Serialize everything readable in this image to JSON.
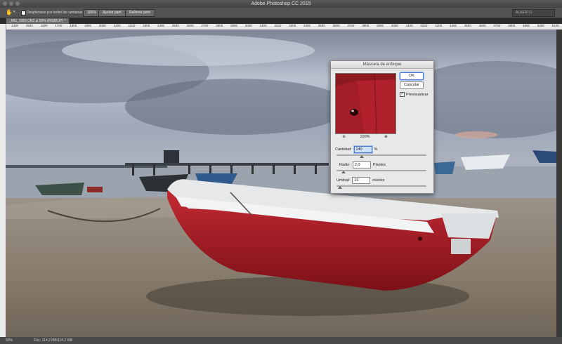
{
  "window": {
    "title": "Adobe Photoshop CC 2015"
  },
  "options_bar": {
    "scroll_all_label": "Desplazarse por todas las ventanas",
    "zoom_100_label": "100%",
    "fit_screen_label": "Ajustar pant.",
    "fill_screen_label": "Rellenar pant.",
    "workspace_label": "ALBERTO"
  },
  "document_tab": {
    "label": "_MG_1993.CR2 al 50% (RGB/16*) *"
  },
  "ruler": {
    "ticks": [
      "1400",
      "1500",
      "1600",
      "1700",
      "1800",
      "1900",
      "2000",
      "2100",
      "2200",
      "2300",
      "2400",
      "2500",
      "2600",
      "2700",
      "2800",
      "2900",
      "3000",
      "3100",
      "3200",
      "3300",
      "3400",
      "3500",
      "3600",
      "3700",
      "3800",
      "3900",
      "4000",
      "4100",
      "4200",
      "4300",
      "4400",
      "4500",
      "4600",
      "4700",
      "4800",
      "4900",
      "5000",
      "5100",
      "5200",
      "5300"
    ]
  },
  "status_bar": {
    "zoom": "50%",
    "doc_info": "Doc: 114,2 MB/114,2 MB"
  },
  "dialog": {
    "title": "Máscara de enfoque",
    "ok_label": "OK",
    "cancel_label": "Cancelar",
    "preview_label": "Previsualizar",
    "preview_checked": true,
    "preview_zoom": "100%",
    "amount": {
      "label": "Cantidad:",
      "value": "140",
      "unit": "%",
      "slider_fraction": 0.28
    },
    "radius": {
      "label": "Radio:",
      "value": "2,0",
      "unit": "Píxeles",
      "slider_fraction": 0.08
    },
    "threshold": {
      "label": "Umbral:",
      "value": "10",
      "unit": "niveles",
      "slider_fraction": 0.04
    }
  },
  "colors": {
    "boat_red": "#b0212b",
    "sky": "#9aa6b8",
    "sand": "#8c8070",
    "dialog_bg": "#e8e8e8",
    "accent": "#4a7acb"
  }
}
